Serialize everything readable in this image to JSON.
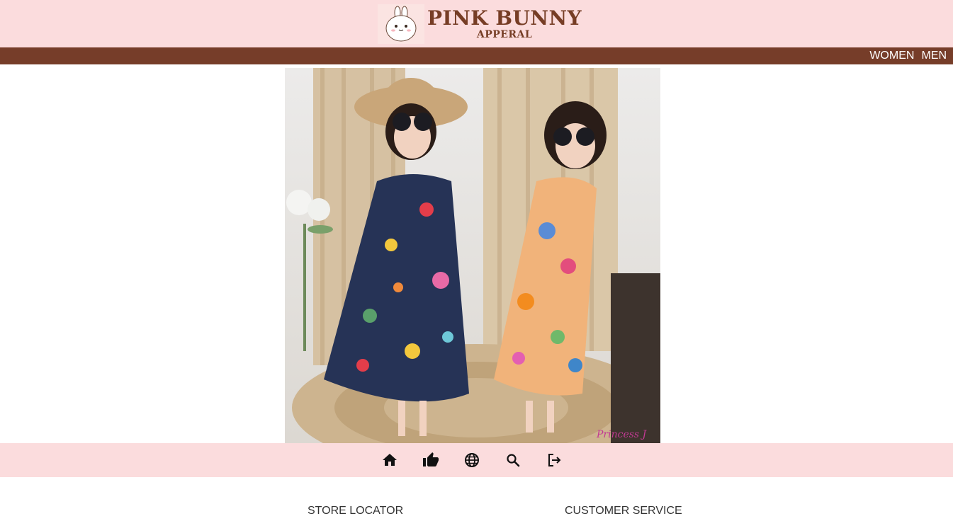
{
  "brand": {
    "title": "PINK BUNNY",
    "subtitle": "APPERAL",
    "mascot_icon": "bunny-mascot"
  },
  "nav": {
    "items": [
      {
        "label": "WOMEN"
      },
      {
        "label": "MEN"
      }
    ]
  },
  "hero": {
    "watermark": "Princess J"
  },
  "toolbar": {
    "icons": [
      "home-icon",
      "thumbs-up-icon",
      "globe-icon",
      "search-icon",
      "logout-icon"
    ]
  },
  "footer": {
    "store_locator": "STORE LOCATOR",
    "customer_service": "CUSTOMER SERVICE"
  },
  "colors": {
    "header_bg": "#fbdcdd",
    "nav_bg": "#763d29",
    "brand_text": "#763d25"
  }
}
